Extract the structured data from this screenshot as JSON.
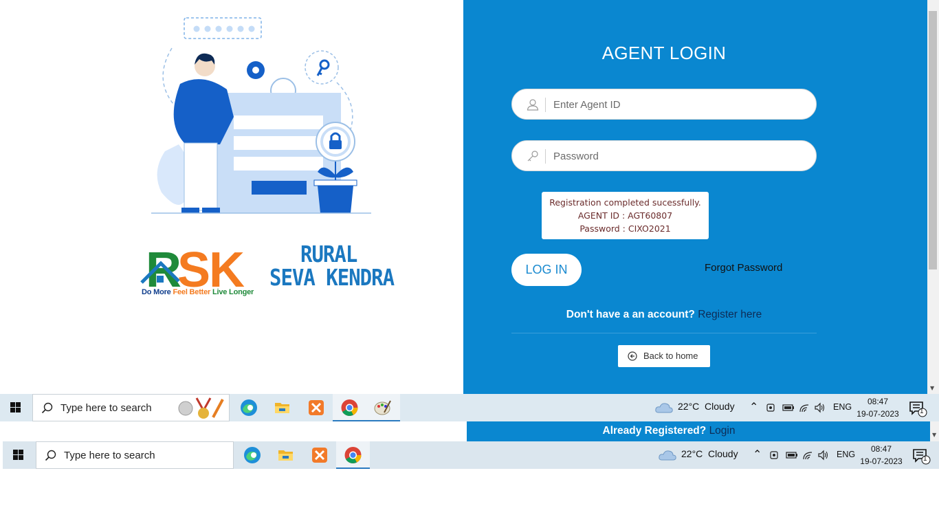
{
  "login": {
    "title": "AGENT LOGIN",
    "agent_id_placeholder": "Enter Agent ID",
    "agent_id_value": "",
    "password_placeholder": "Password",
    "password_value": "",
    "alert": {
      "line1": "Registration completed sucessfully.",
      "line2": "AGENT ID : AGT60807",
      "line3": "Password : CIXO2021"
    },
    "login_button": "LOG IN",
    "forgot_link": "Forgot Password",
    "no_account_text": "Don't have a an account?",
    "register_link": "Register here",
    "back_button": "Back to home",
    "already_text": "Already Registered?",
    "already_link": "Login"
  },
  "branding": {
    "tagline_1": "Do More ",
    "tagline_2": "Feel Better ",
    "tagline_3": "Live Longer",
    "rural": "RURAL",
    "seva_kendra": "SEVA KENDRA",
    "logo_letters": "RSK"
  },
  "taskbar": {
    "search_placeholder": "Type here to search",
    "weather_temp": "22°C",
    "weather_cond": "Cloudy",
    "language": "ENG",
    "time": "08:47",
    "date": "19-07-2023",
    "notification_count": "1"
  },
  "colors": {
    "panel_blue": "#0a87d0",
    "logo_green": "#1f8a3a",
    "logo_orange": "#f47b20",
    "logo_blue": "#1b78c0"
  }
}
